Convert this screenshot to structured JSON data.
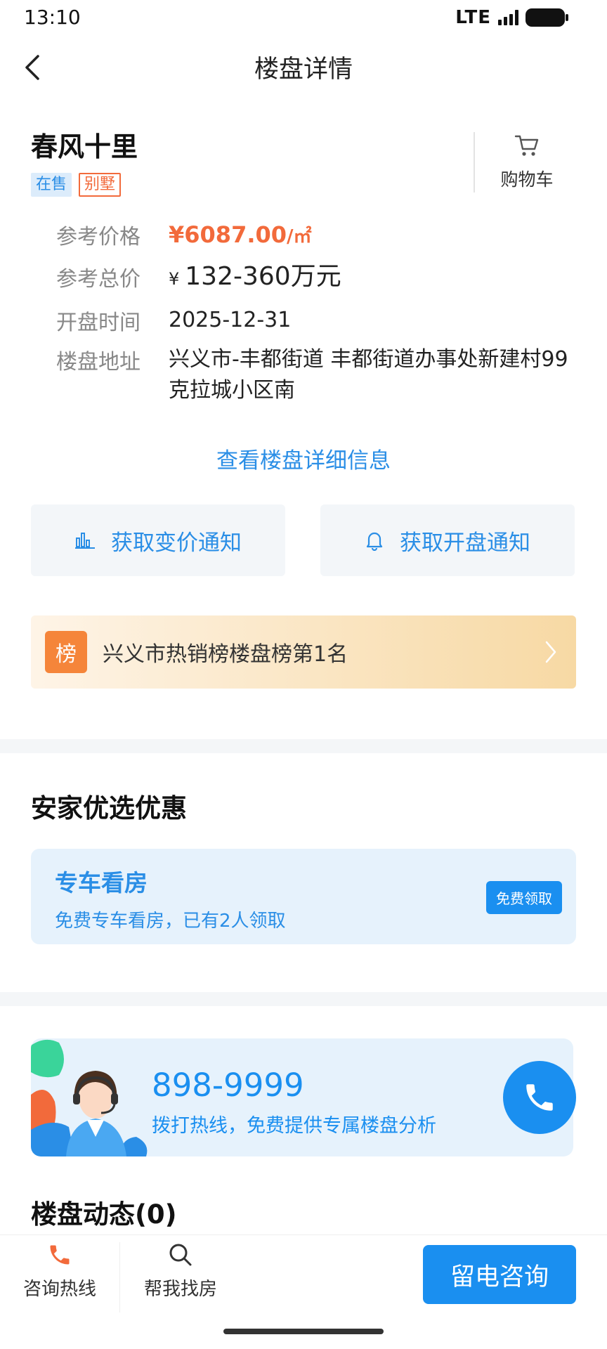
{
  "status": {
    "time": "13:10",
    "network": "LTE"
  },
  "nav": {
    "title": "楼盘详情"
  },
  "project": {
    "name": "春风十里",
    "tags": {
      "sale": "在售",
      "type": "别墅"
    },
    "cart_label": "购物车"
  },
  "info": {
    "price_label": "参考价格",
    "price_value": "¥6087.00",
    "price_unit": "/㎡",
    "total_label": "参考总价",
    "total_currency": "¥",
    "total_value": "132-360万元",
    "open_label": "开盘时间",
    "open_value": "2025-12-31",
    "address_label": "楼盘地址",
    "address_value": "兴义市-丰都街道 丰都街道办事处新建村99克拉城小区南"
  },
  "detail_link": "查看楼盘详细信息",
  "notify": {
    "price_change": "获取变价通知",
    "opening": "获取开盘通知"
  },
  "rank": {
    "badge": "榜",
    "text": "兴义市热销榜楼盘榜第1名"
  },
  "offers": {
    "section_title": "安家优选优惠",
    "title": "专车看房",
    "desc": "免费专车看房，已有2人领取",
    "button": "免费领取"
  },
  "hotline": {
    "number": "898-9999",
    "desc": "拨打热线，免费提供专属楼盘分析"
  },
  "news": {
    "title": "楼盘动态(0)"
  },
  "bottom": {
    "hotline_label": "咨询热线",
    "find_label": "帮我找房",
    "consult_button": "留电咨询"
  },
  "colors": {
    "accent": "#1a8ff0",
    "price": "#f26a3b",
    "rank_badge": "#f5853a"
  }
}
